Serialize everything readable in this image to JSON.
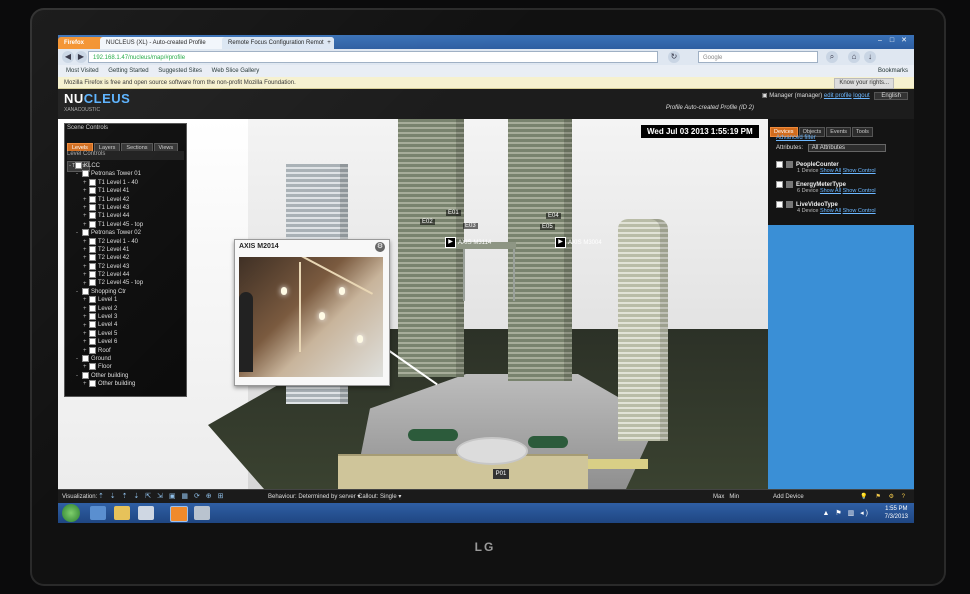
{
  "browser": {
    "firefox_label": "Firefox",
    "tabs": [
      "NUCLEUS (XL) - Auto-created Profile",
      "Remote Focus Configuration Remote..."
    ],
    "new_tab": "+",
    "url": "192.168.1.47/nucleus/map/#profile",
    "search_placeholder": "Google",
    "bookmarks": [
      "Most Visited",
      "Getting Started",
      "Suggested Sites",
      "Web Slice Gallery"
    ],
    "bookmarks_right": "Bookmarks",
    "notification": "Mozilla Firefox is free and open source software from the non-profit Mozilla Foundation.",
    "notification_button": "Know your rights..."
  },
  "app": {
    "logo_part1": "NU",
    "logo_part2": "CLEUS",
    "version": "XANACOUSTIC",
    "user_prefix": "Manager (manager)",
    "user_links": [
      "edit profile",
      "logout"
    ],
    "language": "English",
    "profile": "Profile Auto-created Profile (ID 2)"
  },
  "viewport": {
    "datetime": "Wed Jul 03 2013 1:55:19 PM",
    "markers": [
      "E02",
      "E01",
      "E03",
      "E04",
      "E05",
      "P01"
    ],
    "cameras": [
      "AXIS M3114",
      "AXIS M3004"
    ],
    "popup_title": "AXIS M2014"
  },
  "left_panel": {
    "title": "Scene Controls",
    "tabs": [
      "Levels",
      "Layers",
      "Sections",
      "Views",
      "Tours"
    ],
    "level_header": "Level Controls",
    "tree": [
      {
        "label": "KLCC",
        "indent": 0,
        "exp": "-"
      },
      {
        "label": "Petronas Tower 01",
        "indent": 1,
        "exp": "-"
      },
      {
        "label": "T1 Level 1 - 40",
        "indent": 2,
        "exp": "+"
      },
      {
        "label": "T1 Level 41",
        "indent": 2,
        "exp": "+"
      },
      {
        "label": "T1 Level 42",
        "indent": 2,
        "exp": "+"
      },
      {
        "label": "T1 Level 43",
        "indent": 2,
        "exp": "+"
      },
      {
        "label": "T1 Level 44",
        "indent": 2,
        "exp": "+"
      },
      {
        "label": "T1 Level 45 - top",
        "indent": 2,
        "exp": "+"
      },
      {
        "label": "Petronas Tower 02",
        "indent": 1,
        "exp": "-"
      },
      {
        "label": "T2 Level 1 - 40",
        "indent": 2,
        "exp": "+"
      },
      {
        "label": "T2 Level 41",
        "indent": 2,
        "exp": "+"
      },
      {
        "label": "T2 Level 42",
        "indent": 2,
        "exp": "+"
      },
      {
        "label": "T2 Level 43",
        "indent": 2,
        "exp": "+"
      },
      {
        "label": "T2 Level 44",
        "indent": 2,
        "exp": "+"
      },
      {
        "label": "T2 Level 45 - top",
        "indent": 2,
        "exp": "+"
      },
      {
        "label": "Shopping Ctr",
        "indent": 1,
        "exp": "-"
      },
      {
        "label": "Level 1",
        "indent": 2,
        "exp": "+"
      },
      {
        "label": "Level 2",
        "indent": 2,
        "exp": "+"
      },
      {
        "label": "Level 3",
        "indent": 2,
        "exp": "+"
      },
      {
        "label": "Level 4",
        "indent": 2,
        "exp": "+"
      },
      {
        "label": "Level 5",
        "indent": 2,
        "exp": "+"
      },
      {
        "label": "Level 6",
        "indent": 2,
        "exp": "+"
      },
      {
        "label": "Roof",
        "indent": 2,
        "exp": "+"
      },
      {
        "label": "Ground",
        "indent": 1,
        "exp": "-"
      },
      {
        "label": "Floor",
        "indent": 2,
        "exp": "+"
      },
      {
        "label": "Other building",
        "indent": 1,
        "exp": "-"
      },
      {
        "label": "Other building",
        "indent": 2,
        "exp": "+"
      }
    ]
  },
  "right_panel": {
    "tabs": [
      "Devices",
      "Objects",
      "Events",
      "Tools"
    ],
    "advanced_filter": "Advanced filter",
    "attributes_label": "Attributes:",
    "attributes_value": "All Attributes",
    "items": [
      {
        "name": "PeopleCounter",
        "count": "1 Device",
        "links": [
          "Show All",
          "Show Control"
        ]
      },
      {
        "name": "EnergyMeterType",
        "count": "6 Device",
        "links": [
          "Show All",
          "Show Control"
        ]
      },
      {
        "name": "LiveVideoType",
        "count": "4 Device",
        "links": [
          "Show All",
          "Show Control"
        ]
      }
    ]
  },
  "toolbar": {
    "visualization": "Visualization:",
    "icons": "⇡ ⇣ ⇡ ⇣ ⇱ ⇲ ▣ ▦ ⟳ ⊕ ⊞",
    "behaviour": "Behaviour: Determined by server ▾",
    "callout": "Callout: Single ▾",
    "max": "Max",
    "min": "Min",
    "add_device": "Add Device",
    "right_icons": "💡 ⚑ ⚙ ?"
  },
  "taskbar": {
    "time": "1:55 PM",
    "date": "7/3/2013",
    "tray_icons": "▲ ⚑ ▥ ◂)"
  },
  "monitor": {
    "brand": "LG"
  }
}
